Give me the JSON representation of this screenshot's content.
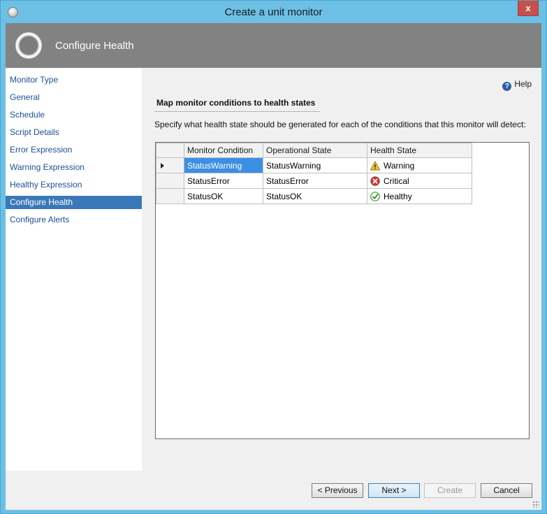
{
  "window": {
    "title": "Create a unit monitor",
    "close_label": "x"
  },
  "banner": {
    "title": "Configure Health"
  },
  "sidebar": {
    "items": [
      {
        "label": "Monitor Type"
      },
      {
        "label": "General"
      },
      {
        "label": "Schedule"
      },
      {
        "label": "Script Details"
      },
      {
        "label": "Error Expression"
      },
      {
        "label": "Warning Expression"
      },
      {
        "label": "Healthy Expression"
      },
      {
        "label": "Configure Health",
        "active": true
      },
      {
        "label": "Configure Alerts"
      }
    ]
  },
  "content": {
    "help_label": "Help",
    "heading": "Map monitor conditions to health states",
    "description": "Specify what health state should be generated for each of the conditions that this monitor will detect:",
    "grid": {
      "columns": [
        "Monitor Condition",
        "Operational State",
        "Health State"
      ],
      "rows": [
        {
          "condition": "StatusWarning",
          "operational": "StatusWarning",
          "health": "Warning",
          "icon": "warning-icon"
        },
        {
          "condition": "StatusError",
          "operational": "StatusError",
          "health": "Critical",
          "icon": "critical-icon"
        },
        {
          "condition": "StatusOK",
          "operational": "StatusOK",
          "health": "Healthy",
          "icon": "healthy-icon"
        }
      ]
    }
  },
  "footer": {
    "previous_label": "< Previous",
    "next_label": "Next >",
    "create_label": "Create",
    "cancel_label": "Cancel"
  },
  "colors": {
    "titlebar": "#6cc0e5",
    "banner": "#828282",
    "nav_active": "#3a78b8",
    "selected_cell": "#3c8fe3",
    "close_button": "#c7504b"
  }
}
